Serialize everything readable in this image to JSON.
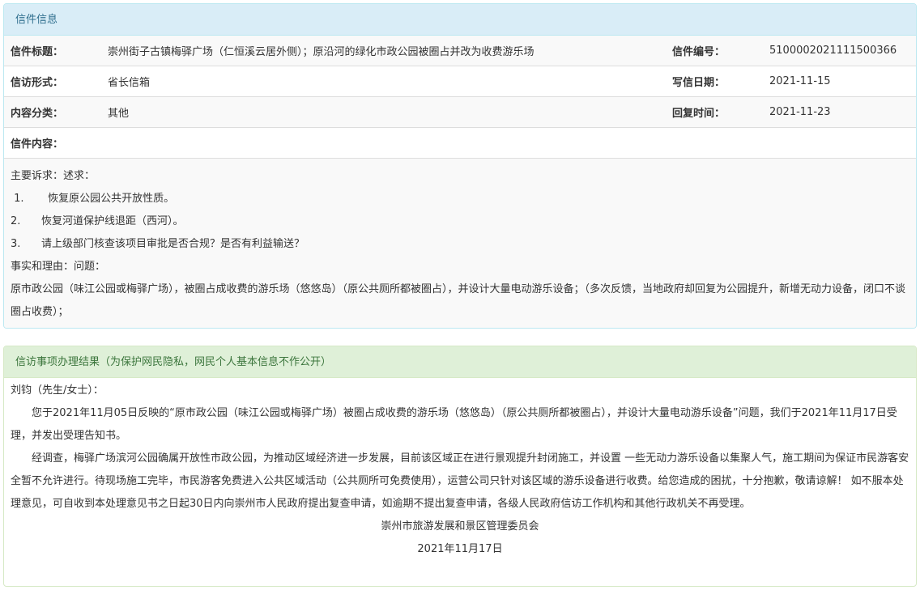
{
  "letter_panel": {
    "heading": "信件信息",
    "title_label": "信件标题：",
    "title_value": "崇州街子古镇梅驿广场（仁恒溪云居外侧）；原沿河的绿化市政公园被圈占并改为收费游乐场",
    "number_label": "信件编号：",
    "number_value": "5100002021111500366",
    "form_label": "信访形式：",
    "form_value": "省长信箱",
    "write_date_label": "写信日期：",
    "write_date_value": "2021-11-15",
    "category_label": "内容分类：",
    "category_value": "其他",
    "reply_time_label": "回复时间：",
    "reply_time_value": "2021-11-23",
    "content_label": "信件内容：",
    "content": {
      "demands_heading": "主要诉求：述求：",
      "demands": [
        {
          "num": "1.",
          "text": "恢复原公园公共开放性质。"
        },
        {
          "num": "2.",
          "text": "恢复河道保护线退距（西河）。"
        },
        {
          "num": "3.",
          "text": "请上级部门核查该项目审批是否合规？是否有利益输送？"
        }
      ],
      "reasons_heading": "事实和理由：问题：",
      "reasons_text": "原市政公园（味江公园或梅驿广场），被圈占成收费的游乐场（悠悠岛）（原公共厕所都被圈占），并设计大量电动游乐设备；（多次反馈，当地政府却回复为公园提升，新增无动力设备，闭口不谈圈占收费）；"
    }
  },
  "result_panel": {
    "heading": "信访事项办理结果（为保护网民隐私，网民个人基本信息不作公开）",
    "salutation": "刘钧（先生/女士）：",
    "paragraph1": "您于2021年11月05日反映的“原市政公园（味江公园或梅驿广场）被圈占成收费的游乐场（悠悠岛）（原公共厕所都被圈占），并设计大量电动游乐设备”问题，我们于2021年11月17日受理，并发出受理告知书。",
    "paragraph2": "经调查，梅驿广场滨河公园确属开放性市政公园，为推动区域经济进一步发展，目前该区域正在进行景观提升封闭施工，并设置 一些无动力游乐设备以集聚人气，施工期间为保证市民游客安全暂不允许进行。待现场施工完毕，市民游客免费进入公共区域活动（公共厕所可免费使用），运营公司只针对该区域的游乐设备进行收费。给您造成的困扰，十分抱歉，敬请谅解！ 如不服本处理意见，可自收到本处理意见书之日起30日内向崇州市人民政府提出复查申请，如逾期不提出复查申请，各级人民政府信访工作机构和其他行政机关不再受理。",
    "signature_org": "崇州市旅游发展和景区管理委员会",
    "signature_date": "2021年11月17日"
  }
}
